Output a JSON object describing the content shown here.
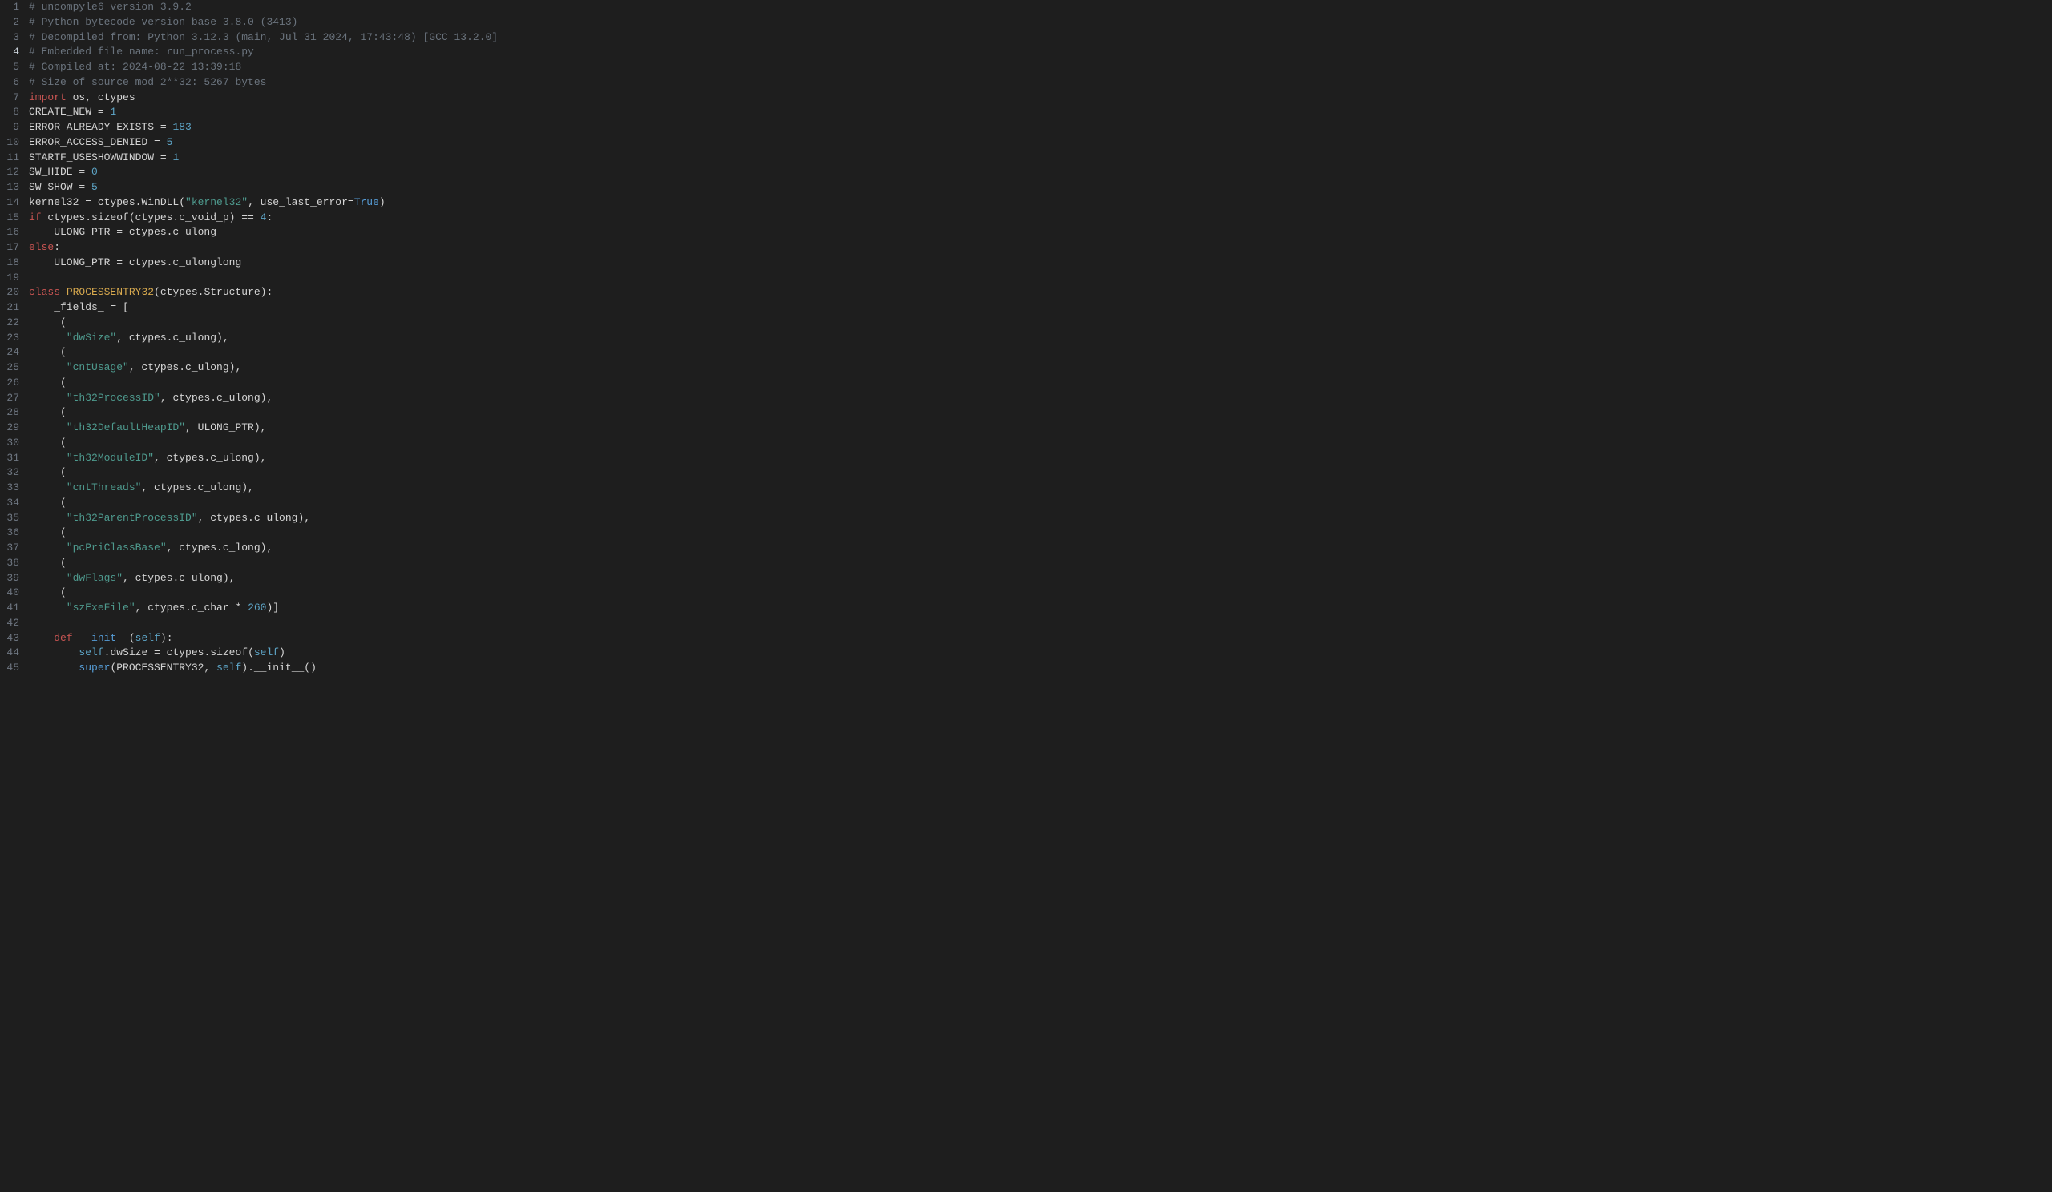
{
  "editor": {
    "current_line": 4,
    "lines": [
      {
        "n": 1,
        "tokens": [
          [
            "# uncompyle6 version 3.9.2",
            "comment"
          ]
        ]
      },
      {
        "n": 2,
        "tokens": [
          [
            "# Python bytecode version base 3.8.0 (3413)",
            "comment"
          ]
        ]
      },
      {
        "n": 3,
        "tokens": [
          [
            "# Decompiled from: Python 3.12.3 (main, Jul 31 2024, 17:43:48) [GCC 13.2.0]",
            "comment"
          ]
        ]
      },
      {
        "n": 4,
        "tokens": [
          [
            "# Embedded file name: run_process.py",
            "comment"
          ]
        ]
      },
      {
        "n": 5,
        "tokens": [
          [
            "# Compiled at: 2024-08-22 13:39:18",
            "comment"
          ]
        ]
      },
      {
        "n": 6,
        "tokens": [
          [
            "# Size of source mod 2**32: 5267 bytes",
            "comment"
          ]
        ]
      },
      {
        "n": 7,
        "tokens": [
          [
            "import",
            "keyword"
          ],
          [
            " os, ctypes",
            "default"
          ]
        ]
      },
      {
        "n": 8,
        "tokens": [
          [
            "CREATE_NEW = ",
            "default"
          ],
          [
            "1",
            "number"
          ]
        ]
      },
      {
        "n": 9,
        "tokens": [
          [
            "ERROR_ALREADY_EXISTS = ",
            "default"
          ],
          [
            "183",
            "number"
          ]
        ]
      },
      {
        "n": 10,
        "tokens": [
          [
            "ERROR_ACCESS_DENIED = ",
            "default"
          ],
          [
            "5",
            "number"
          ]
        ]
      },
      {
        "n": 11,
        "tokens": [
          [
            "STARTF_USESHOWWINDOW = ",
            "default"
          ],
          [
            "1",
            "number"
          ]
        ]
      },
      {
        "n": 12,
        "tokens": [
          [
            "SW_HIDE = ",
            "default"
          ],
          [
            "0",
            "number"
          ]
        ]
      },
      {
        "n": 13,
        "tokens": [
          [
            "SW_SHOW = ",
            "default"
          ],
          [
            "5",
            "number"
          ]
        ]
      },
      {
        "n": 14,
        "tokens": [
          [
            "kernel32 = ctypes.WinDLL(",
            "default"
          ],
          [
            "\"kernel32\"",
            "string"
          ],
          [
            ", use_last_error=",
            "default"
          ],
          [
            "True",
            "bool"
          ],
          [
            ")",
            "default"
          ]
        ]
      },
      {
        "n": 15,
        "tokens": [
          [
            "if",
            "keyword"
          ],
          [
            " ctypes.sizeof(ctypes.c_void_p) == ",
            "default"
          ],
          [
            "4",
            "number"
          ],
          [
            ":",
            "default"
          ]
        ]
      },
      {
        "n": 16,
        "tokens": [
          [
            "    ULONG_PTR = ctypes.c_ulong",
            "default"
          ]
        ]
      },
      {
        "n": 17,
        "tokens": [
          [
            "else",
            "keyword"
          ],
          [
            ":",
            "default"
          ]
        ]
      },
      {
        "n": 18,
        "tokens": [
          [
            "    ULONG_PTR = ctypes.c_ulonglong",
            "default"
          ]
        ]
      },
      {
        "n": 19,
        "tokens": [
          [
            "",
            "default"
          ]
        ]
      },
      {
        "n": 20,
        "tokens": [
          [
            "class",
            "keyword"
          ],
          [
            " ",
            "default"
          ],
          [
            "PROCESSENTRY32",
            "class"
          ],
          [
            "(ctypes.Structure):",
            "default"
          ]
        ]
      },
      {
        "n": 21,
        "tokens": [
          [
            "    _fields_ = [",
            "default"
          ]
        ]
      },
      {
        "n": 22,
        "tokens": [
          [
            "     (",
            "default"
          ]
        ]
      },
      {
        "n": 23,
        "tokens": [
          [
            "      ",
            "default"
          ],
          [
            "\"dwSize\"",
            "string"
          ],
          [
            ", ctypes.c_ulong),",
            "default"
          ]
        ]
      },
      {
        "n": 24,
        "tokens": [
          [
            "     (",
            "default"
          ]
        ]
      },
      {
        "n": 25,
        "tokens": [
          [
            "      ",
            "default"
          ],
          [
            "\"cntUsage\"",
            "string"
          ],
          [
            ", ctypes.c_ulong),",
            "default"
          ]
        ]
      },
      {
        "n": 26,
        "tokens": [
          [
            "     (",
            "default"
          ]
        ]
      },
      {
        "n": 27,
        "tokens": [
          [
            "      ",
            "default"
          ],
          [
            "\"th32ProcessID\"",
            "string"
          ],
          [
            ", ctypes.c_ulong),",
            "default"
          ]
        ]
      },
      {
        "n": 28,
        "tokens": [
          [
            "     (",
            "default"
          ]
        ]
      },
      {
        "n": 29,
        "tokens": [
          [
            "      ",
            "default"
          ],
          [
            "\"th32DefaultHeapID\"",
            "string"
          ],
          [
            ", ULONG_PTR),",
            "default"
          ]
        ]
      },
      {
        "n": 30,
        "tokens": [
          [
            "     (",
            "default"
          ]
        ]
      },
      {
        "n": 31,
        "tokens": [
          [
            "      ",
            "default"
          ],
          [
            "\"th32ModuleID\"",
            "string"
          ],
          [
            ", ctypes.c_ulong),",
            "default"
          ]
        ]
      },
      {
        "n": 32,
        "tokens": [
          [
            "     (",
            "default"
          ]
        ]
      },
      {
        "n": 33,
        "tokens": [
          [
            "      ",
            "default"
          ],
          [
            "\"cntThreads\"",
            "string"
          ],
          [
            ", ctypes.c_ulong),",
            "default"
          ]
        ]
      },
      {
        "n": 34,
        "tokens": [
          [
            "     (",
            "default"
          ]
        ]
      },
      {
        "n": 35,
        "tokens": [
          [
            "      ",
            "default"
          ],
          [
            "\"th32ParentProcessID\"",
            "string"
          ],
          [
            ", ctypes.c_ulong),",
            "default"
          ]
        ]
      },
      {
        "n": 36,
        "tokens": [
          [
            "     (",
            "default"
          ]
        ]
      },
      {
        "n": 37,
        "tokens": [
          [
            "      ",
            "default"
          ],
          [
            "\"pcPriClassBase\"",
            "string"
          ],
          [
            ", ctypes.c_long),",
            "default"
          ]
        ]
      },
      {
        "n": 38,
        "tokens": [
          [
            "     (",
            "default"
          ]
        ]
      },
      {
        "n": 39,
        "tokens": [
          [
            "      ",
            "default"
          ],
          [
            "\"dwFlags\"",
            "string"
          ],
          [
            ", ctypes.c_ulong),",
            "default"
          ]
        ]
      },
      {
        "n": 40,
        "tokens": [
          [
            "     (",
            "default"
          ]
        ]
      },
      {
        "n": 41,
        "tokens": [
          [
            "      ",
            "default"
          ],
          [
            "\"szExeFile\"",
            "string"
          ],
          [
            ", ctypes.c_char * ",
            "default"
          ],
          [
            "260",
            "number"
          ],
          [
            ")]",
            "default"
          ]
        ]
      },
      {
        "n": 42,
        "tokens": [
          [
            "",
            "default"
          ]
        ]
      },
      {
        "n": 43,
        "tokens": [
          [
            "    ",
            "default"
          ],
          [
            "def",
            "keyword"
          ],
          [
            " ",
            "default"
          ],
          [
            "__init__",
            "func"
          ],
          [
            "(",
            "default"
          ],
          [
            "self",
            "self"
          ],
          [
            "):",
            "default"
          ]
        ]
      },
      {
        "n": 44,
        "tokens": [
          [
            "        ",
            "default"
          ],
          [
            "self",
            "self"
          ],
          [
            ".dwSize = ctypes.sizeof(",
            "default"
          ],
          [
            "self",
            "self"
          ],
          [
            ")",
            "default"
          ]
        ]
      },
      {
        "n": 45,
        "tokens": [
          [
            "        ",
            "default"
          ],
          [
            "super",
            "func"
          ],
          [
            "(PROCESSENTRY32, ",
            "default"
          ],
          [
            "self",
            "self"
          ],
          [
            ").__init__()",
            "default"
          ]
        ]
      }
    ]
  }
}
